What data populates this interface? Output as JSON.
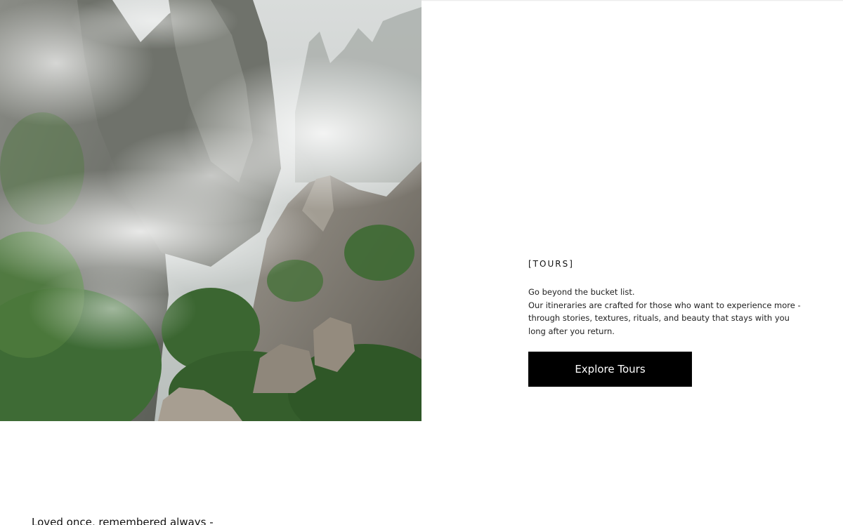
{
  "hero": {
    "image_icon": "misty-mountain-landscape-photo"
  },
  "tours": {
    "section_label": "[TOURS]",
    "intro": "Go beyond the bucket list.",
    "body": "Our itineraries are crafted for those who want to experience more - through stories, textures, rituals, and beauty that stays with you long after you return.",
    "button_label": "Explore Tours"
  },
  "tagline": {
    "text": "Loved once, remembered always -"
  },
  "colors": {
    "button_bg": "#000000",
    "button_text": "#ffffff",
    "page_bg": "#ffffff"
  }
}
